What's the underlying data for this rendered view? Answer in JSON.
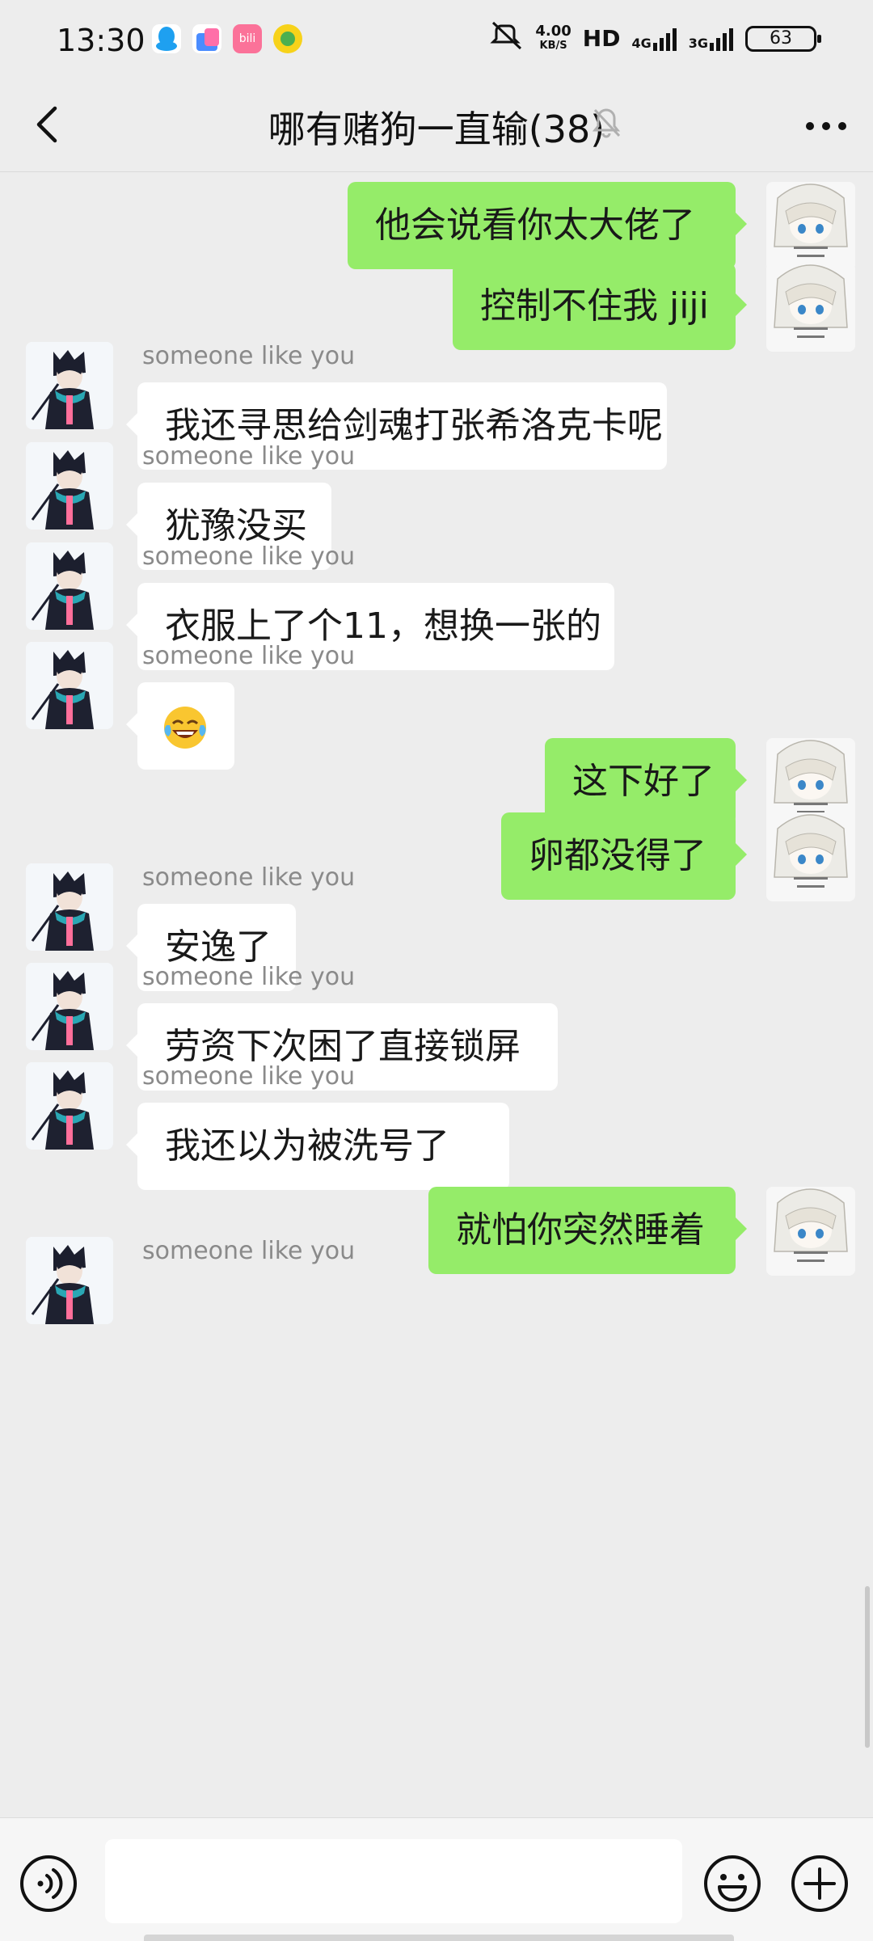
{
  "status_bar": {
    "time": "13:30",
    "network_speed_value": "4.00",
    "network_speed_unit": "KB/S",
    "hd_label": "HD",
    "net1_label": "4G",
    "net2_label": "3G",
    "battery": "63",
    "app_icons": [
      "qq-icon",
      "shopping-icon",
      "bilibili-icon",
      "music-icon"
    ]
  },
  "header": {
    "title": "哪有赌狗一直输(38)",
    "muted": true
  },
  "messages": [
    {
      "side": "me",
      "text": "他会说看你太大佬了"
    },
    {
      "side": "me",
      "text": "控制不住我 jiji"
    },
    {
      "side": "them",
      "sender": "someone like you",
      "text": "我还寻思给剑魂打张希洛克卡呢"
    },
    {
      "side": "them",
      "sender": "someone like you",
      "text": "犹豫没买"
    },
    {
      "side": "them",
      "sender": "someone like you",
      "text": "衣服上了个11，想换一张的"
    },
    {
      "side": "them",
      "sender": "someone like you",
      "emoji": "laughing-tears-emoji"
    },
    {
      "side": "me",
      "text": "这下好了"
    },
    {
      "side": "me",
      "text": "卵都没得了"
    },
    {
      "side": "them",
      "sender": "someone like you",
      "text": "安逸了"
    },
    {
      "side": "them",
      "sender": "someone like you",
      "text": "劳资下次困了直接锁屏"
    },
    {
      "side": "them",
      "sender": "someone like you",
      "text": "我还以为被洗号了"
    },
    {
      "side": "me",
      "text": "就怕你突然睡着"
    },
    {
      "side": "them",
      "sender": "someone like you",
      "text": ""
    }
  ],
  "input": {
    "value": "",
    "placeholder": ""
  },
  "colors": {
    "background": "#ededed",
    "my_bubble": "#95ec69",
    "their_bubble": "#ffffff"
  }
}
